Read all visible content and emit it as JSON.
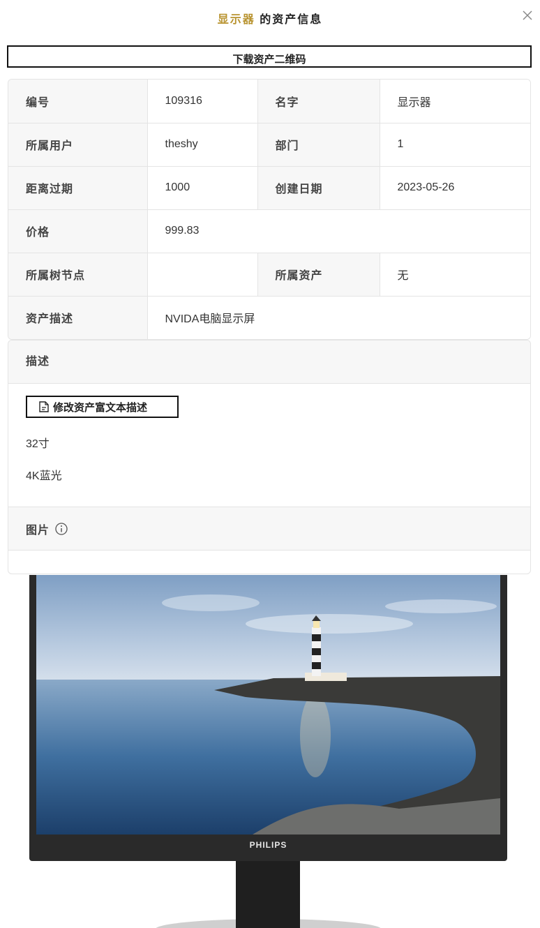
{
  "modal": {
    "title_accent": "显示器",
    "title_rest": " 的资产信息",
    "close_label": "×"
  },
  "qr_button": {
    "label": "下载资产二维码"
  },
  "info": {
    "number_label": "编号",
    "number_value": "109316",
    "name_label": "名字",
    "name_value": "显示器",
    "owner_label": "所属用户",
    "owner_value": "theshy",
    "dept_label": "部门",
    "dept_value": "1",
    "expire_label": "距离过期",
    "expire_value": "1000",
    "created_label": "创建日期",
    "created_value": "2023-05-26",
    "price_label": "价格",
    "price_value": "999.83",
    "tree_label": "所属树节点",
    "tree_value": "",
    "parent_label": "所属资产",
    "parent_value": "无",
    "desc_label": "资产描述",
    "desc_value": "NVIDA电脑显示屏"
  },
  "description": {
    "header": "描述",
    "edit_button": "修改资产富文本描述",
    "lines": [
      "32寸",
      "4K蓝光"
    ]
  },
  "images": {
    "header": "图片"
  },
  "monitor": {
    "brand": "PHILIPS"
  },
  "colors": {
    "accent": "#b8932f",
    "header_bg": "#f7f7f7",
    "border": "#e4e4e4"
  }
}
